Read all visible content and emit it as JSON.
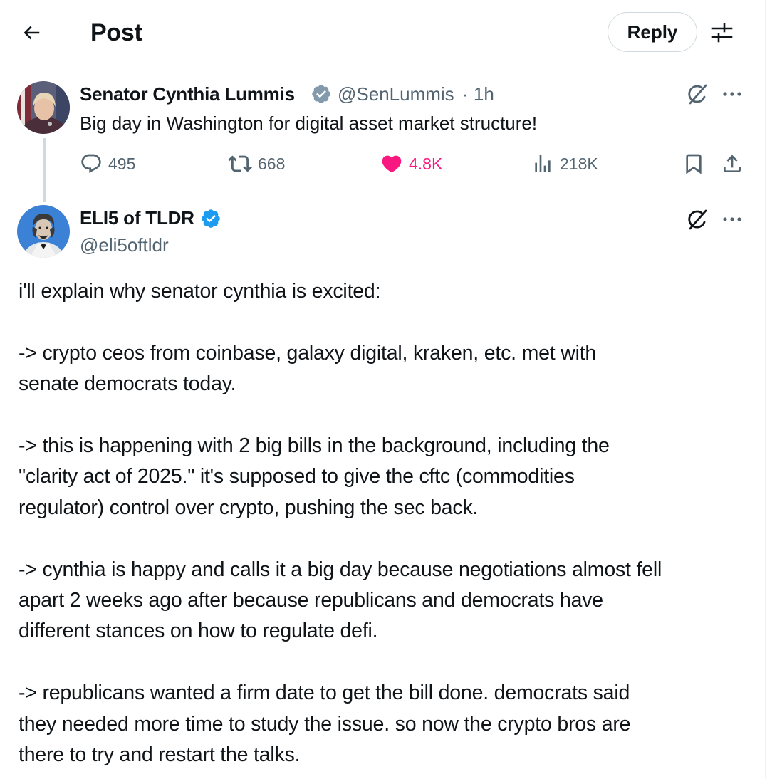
{
  "header": {
    "title": "Post",
    "reply_label": "Reply"
  },
  "parent_tweet": {
    "author_name": "Senator Cynthia Lummis",
    "handle": "@SenLummis",
    "time": "· 1h",
    "text": "Big day in Washington for digital asset market structure!",
    "stats": {
      "replies": "495",
      "reposts": "668",
      "likes": "4.8K",
      "views": "218K"
    },
    "liked": true
  },
  "reply_tweet": {
    "author_name": "ELI5 of TLDR",
    "handle": "@eli5oftldr",
    "paragraphs": [
      [
        "i'll explain why senator cynthia is excited:"
      ],
      [
        "-> crypto ceos from coinbase, galaxy digital, kraken, etc. met with",
        "senate democrats today."
      ],
      [
        "-> this is happening with 2 big bills in the background, including the",
        "\"clarity act of 2025.\" it's supposed to give the cftc (commodities",
        "regulator) control over crypto, pushing the sec back."
      ],
      [
        "-> cynthia is happy and calls it a big day because negotiations almost fell",
        "apart 2 weeks ago after because republicans and democrats have",
        "different stances on how to regulate defi."
      ],
      [
        "-> republicans wanted a firm date to get the bill done. democrats said",
        "they needed more time to study the issue. so now the crypto bros are",
        "there to try and restart the talks."
      ]
    ]
  },
  "colors": {
    "text": "#0f1419",
    "secondary": "#536471",
    "like": "#f91880",
    "verified_blue": "#1d9bf0",
    "verified_gray": "#829aab",
    "border": "#cfd9de"
  },
  "icons": {
    "back": "arrow-left-icon",
    "settings": "sliders-icon",
    "grok": "grok-slash-icon",
    "more": "more-dots-icon",
    "reply": "speech-bubble-icon",
    "repost": "repost-arrows-icon",
    "like": "heart-icon",
    "views": "bar-chart-icon",
    "bookmark": "bookmark-icon",
    "share": "share-upload-icon"
  }
}
